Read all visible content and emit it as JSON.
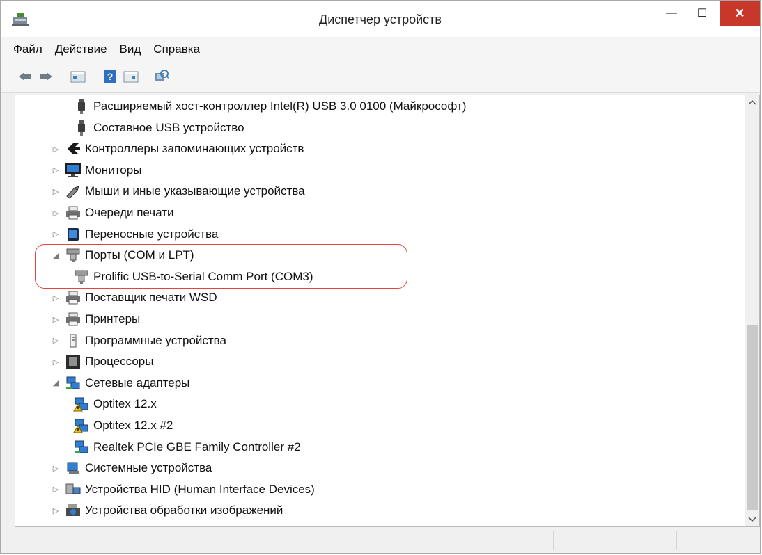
{
  "window": {
    "title": "Диспетчер устройств",
    "controls": {
      "minimize": "—",
      "maximize": "☐",
      "close": "✕"
    }
  },
  "menu": [
    "Файл",
    "Действие",
    "Вид",
    "Справка"
  ],
  "toolbar": {
    "icons": [
      "back-arrow-icon",
      "forward-arrow-icon",
      "properties-icon",
      "help-icon",
      "view-icon",
      "scan-hardware-icon"
    ]
  },
  "tree": [
    {
      "label": "Расширяемый хост-контроллер Intel(R) USB 3.0 0100 (Майкрософт)",
      "level": 2,
      "expander": "",
      "icon": "usb-plug-icon"
    },
    {
      "label": "Составное USB устройство",
      "level": 2,
      "expander": "",
      "icon": "usb-plug-icon"
    },
    {
      "label": "Контроллеры запоминающих устройств",
      "level": 1,
      "expander": "▷",
      "icon": "storage-controller-icon"
    },
    {
      "label": "Мониторы",
      "level": 1,
      "expander": "▷",
      "icon": "monitor-icon"
    },
    {
      "label": "Мыши и иные указывающие устройства",
      "level": 1,
      "expander": "▷",
      "icon": "mouse-icon"
    },
    {
      "label": "Очереди печати",
      "level": 1,
      "expander": "▷",
      "icon": "printer-icon"
    },
    {
      "label": "Переносные устройства",
      "level": 1,
      "expander": "▷",
      "icon": "portable-device-icon"
    },
    {
      "label": "Порты (COM и LPT)",
      "level": 1,
      "expander": "◢",
      "icon": "port-icon"
    },
    {
      "label": "Prolific USB-to-Serial Comm Port (COM3)",
      "level": 2,
      "expander": "",
      "icon": "port-icon"
    },
    {
      "label": "Поставщик печати WSD",
      "level": 1,
      "expander": "▷",
      "icon": "printer-icon"
    },
    {
      "label": "Принтеры",
      "level": 1,
      "expander": "▷",
      "icon": "printer-icon"
    },
    {
      "label": "Программные устройства",
      "level": 1,
      "expander": "▷",
      "icon": "software-device-icon"
    },
    {
      "label": "Процессоры",
      "level": 1,
      "expander": "▷",
      "icon": "processor-icon"
    },
    {
      "label": "Сетевые адаптеры",
      "level": 1,
      "expander": "◢",
      "icon": "network-adapter-icon"
    },
    {
      "label": "Optitex 12.x",
      "level": 2,
      "expander": "",
      "icon": "network-adapter-warning-icon"
    },
    {
      "label": "Optitex 12.x #2",
      "level": 2,
      "expander": "",
      "icon": "network-adapter-warning-icon"
    },
    {
      "label": "Realtek PCIe GBE Family Controller #2",
      "level": 2,
      "expander": "",
      "icon": "network-adapter-icon"
    },
    {
      "label": "Системные устройства",
      "level": 1,
      "expander": "▷",
      "icon": "system-device-icon"
    },
    {
      "label": "Устройства HID (Human Interface Devices)",
      "level": 1,
      "expander": "▷",
      "icon": "hid-icon"
    },
    {
      "label": "Устройства обработки изображений",
      "level": 1,
      "expander": "▷",
      "icon": "imaging-device-icon"
    }
  ],
  "colors": {
    "highlight": "#e0463d",
    "close_button": "#c7382b"
  }
}
